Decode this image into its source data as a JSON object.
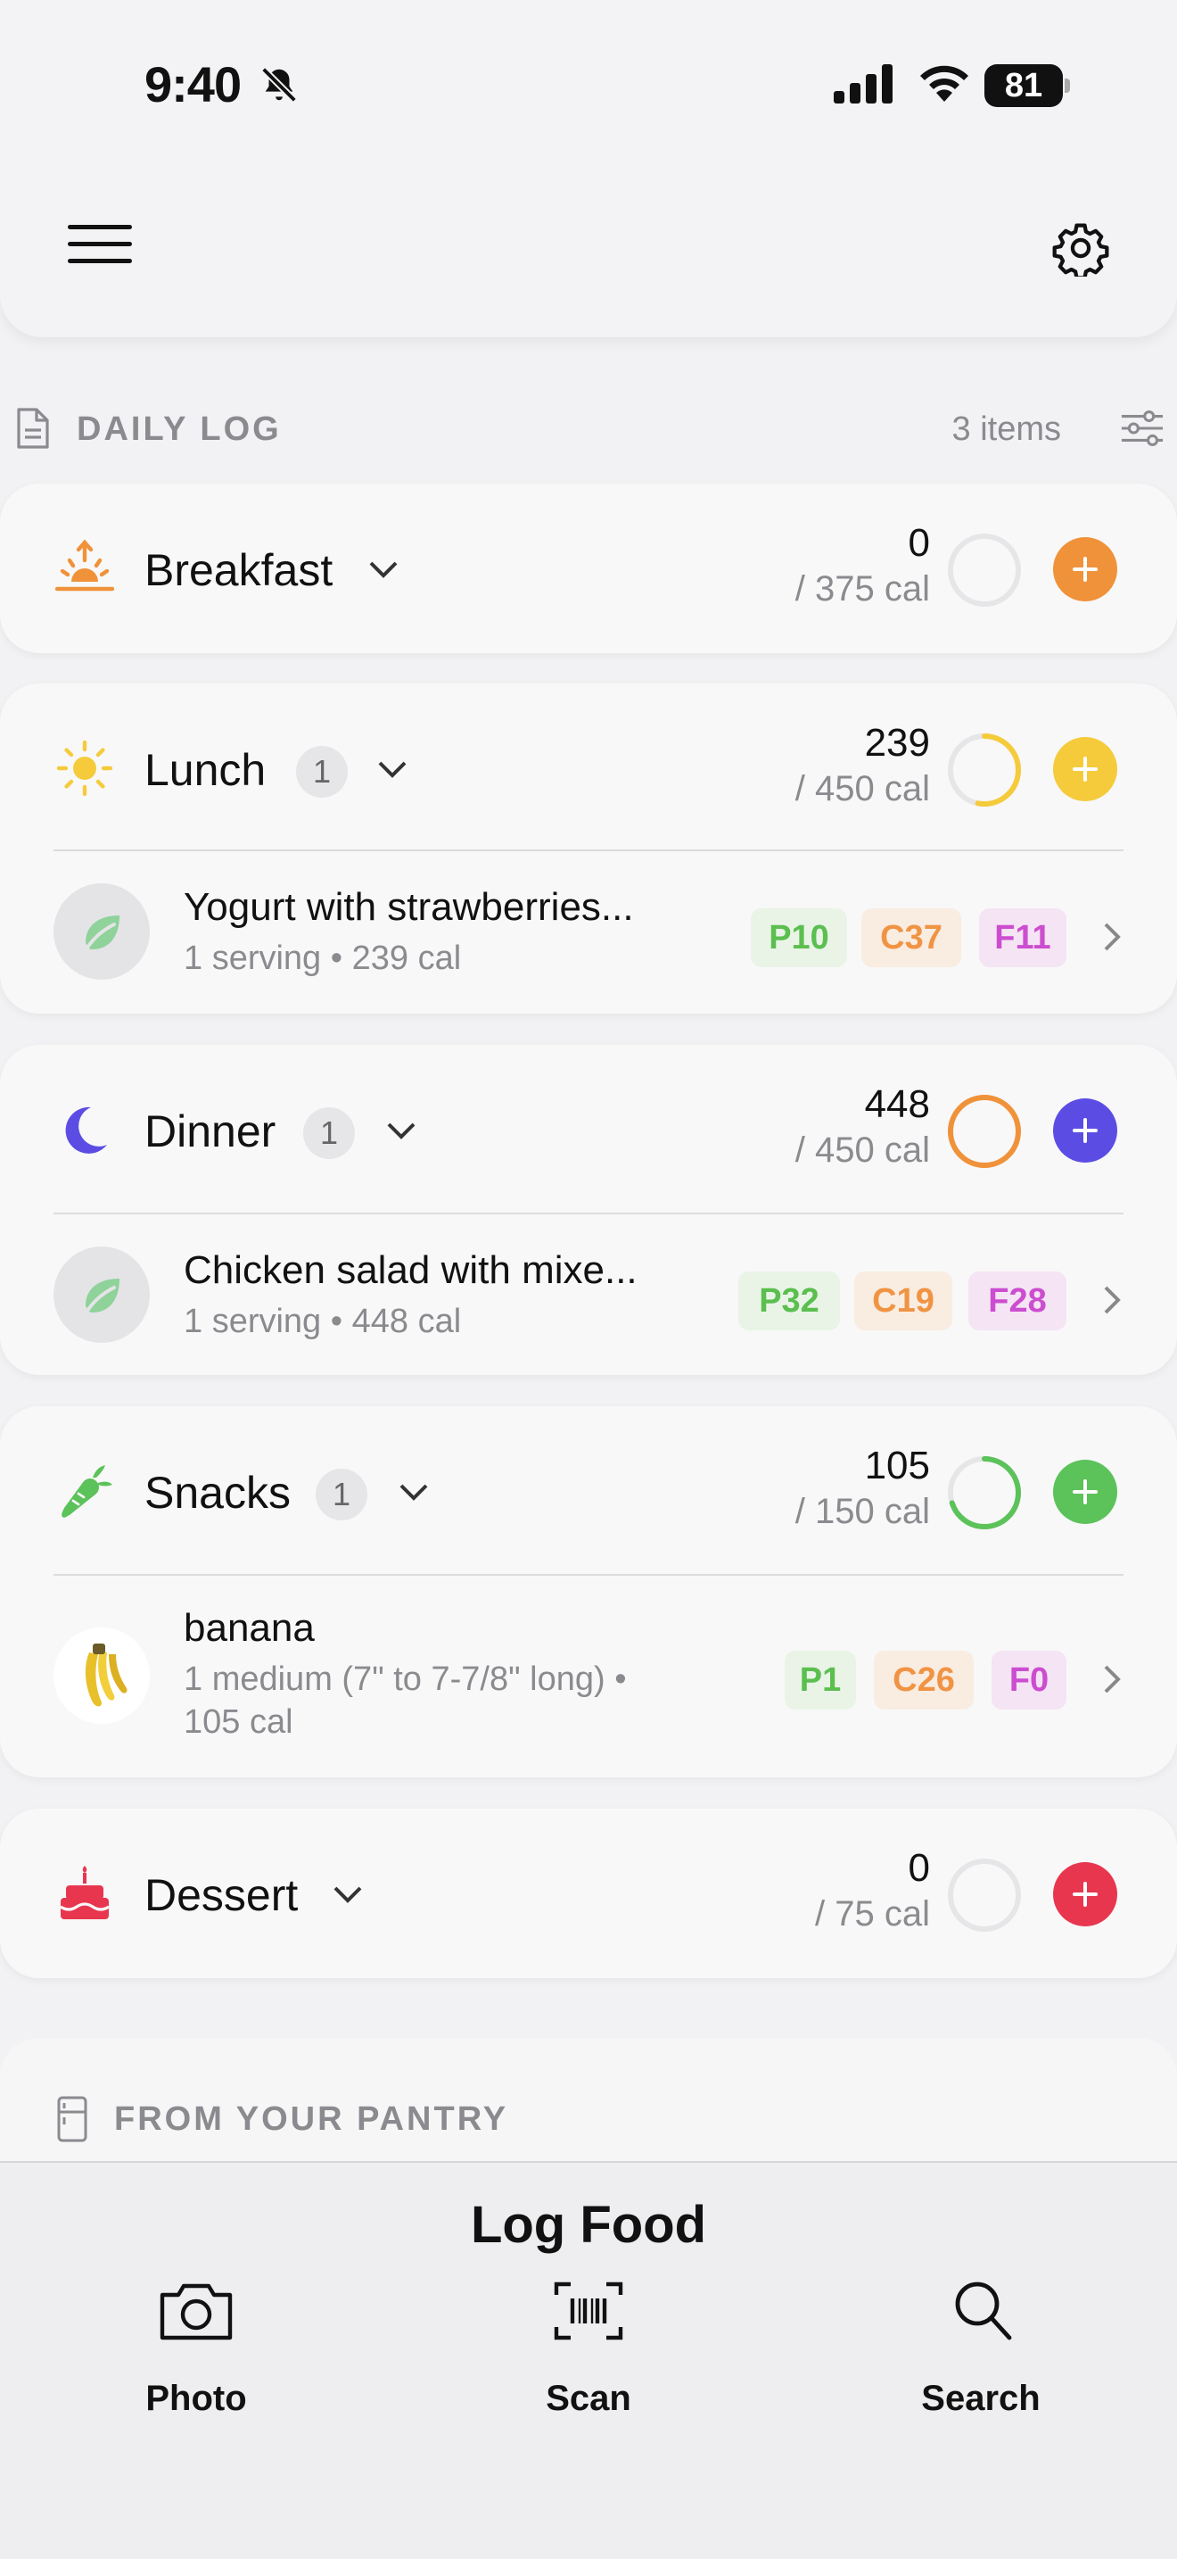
{
  "status_bar": {
    "time": "9:40",
    "battery": "81"
  },
  "daily_log": {
    "title": "DAILY LOG",
    "items_count": "3 items",
    "meals": [
      {
        "name": "Breakfast",
        "calories": "0",
        "goal": "/ 375 cal",
        "progress": 0,
        "color": "#f0923a",
        "count": ""
      },
      {
        "name": "Lunch",
        "calories": "239",
        "goal": "/ 450 cal",
        "progress": 0.53,
        "color": "#f5cb3c",
        "count": "1",
        "food": {
          "name": "Yogurt with strawberries...",
          "detail": "1 serving • 239 cal",
          "protein": "P10",
          "carbs": "C37",
          "fat": "F11"
        }
      },
      {
        "name": "Dinner",
        "calories": "448",
        "goal": "/ 450 cal",
        "progress": 0.996,
        "color": "#5b4de4",
        "ring_color": "#f0923a",
        "count": "1",
        "food": {
          "name": "Chicken salad with mixe...",
          "detail": "1 serving • 448 cal",
          "protein": "P32",
          "carbs": "C19",
          "fat": "F28"
        }
      },
      {
        "name": "Snacks",
        "calories": "105",
        "goal": "/ 150 cal",
        "progress": 0.7,
        "color": "#5cc25a",
        "count": "1",
        "food": {
          "name": "banana",
          "detail_line1": "1 medium (7\" to 7-7/8\" long) •",
          "detail_line2": "105 cal",
          "protein": "P1",
          "carbs": "C26",
          "fat": "F0"
        }
      },
      {
        "name": "Dessert",
        "calories": "0",
        "goal": "/ 75 cal",
        "progress": 0,
        "color": "#e8364f",
        "count": ""
      }
    ]
  },
  "pantry": {
    "title": "FROM YOUR PANTRY"
  },
  "log_food": {
    "title": "Log Food",
    "actions": [
      {
        "label": "Photo"
      },
      {
        "label": "Scan"
      },
      {
        "label": "Search"
      }
    ]
  }
}
